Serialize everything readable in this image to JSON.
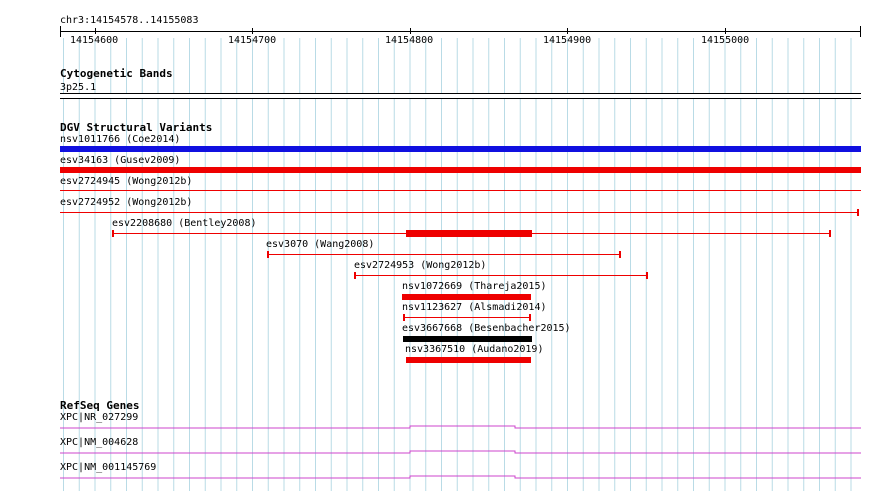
{
  "ruler": {
    "locus": "chr3:14154578..14155083",
    "ticks": [
      "14154600",
      "14154700",
      "14154800",
      "14154900",
      "14155000"
    ]
  },
  "tracks": {
    "cytoband": {
      "title": "Cytogenetic Bands",
      "band": "3p25.1"
    },
    "dgv": {
      "title": "DGV Structural Variants",
      "variants": [
        {
          "label": "nsv1011766 (Coe2014)",
          "color": "#1010e0",
          "style": "thick"
        },
        {
          "label": "esv34163 (Gusev2009)",
          "color": "#ee0000",
          "style": "thick"
        },
        {
          "label": "esv2724945 (Wong2012b)",
          "color": "#ee0000",
          "style": "thin"
        },
        {
          "label": "esv2724952 (Wong2012b)",
          "color": "#ee0000",
          "style": "thin"
        },
        {
          "label": "esv2208680 (Bentley2008)",
          "color": "#ee0000",
          "style": "mixed"
        },
        {
          "label": "esv3070 (Wang2008)",
          "color": "#ee0000",
          "style": "thin"
        },
        {
          "label": "esv2724953 (Wong2012b)",
          "color": "#ee0000",
          "style": "thin"
        },
        {
          "label": "nsv1072669 (Thareja2015)",
          "color": "#ee0000",
          "style": "thick"
        },
        {
          "label": "nsv1123627 (Alsmadi2014)",
          "color": "#ee0000",
          "style": "thin"
        },
        {
          "label": "esv3667668 (Besenbacher2015)",
          "color": "#000000",
          "style": "thick"
        },
        {
          "label": "nsv3367510 (Audano2019)",
          "color": "#ee0000",
          "style": "thick"
        }
      ]
    },
    "refseq": {
      "title": "RefSeq Genes",
      "genes": [
        {
          "label": "XPC|NR_027299",
          "color": "#cc44cc"
        },
        {
          "label": "XPC|NM_004628",
          "color": "#cc44cc"
        },
        {
          "label": "XPC|NM_001145769",
          "color": "#cc44cc"
        }
      ]
    }
  }
}
